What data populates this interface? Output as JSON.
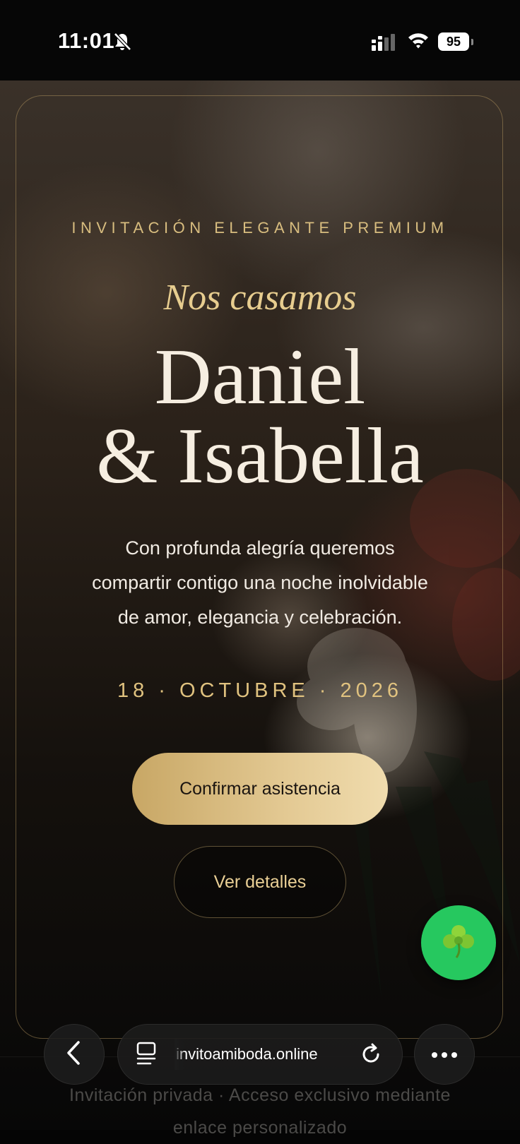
{
  "status_bar": {
    "time": "11:01",
    "battery": "95",
    "icons": [
      "bell-slash-icon",
      "signal-icon",
      "wifi-icon",
      "battery-icon"
    ]
  },
  "hero": {
    "kicker": "INVITACIÓN ELEGANTE PREMIUM",
    "script_title": "Nos casamos",
    "name_line_1": "Daniel",
    "name_line_2": "& Isabella",
    "intro_line_1": "Con profunda alegría queremos",
    "intro_line_2": "compartir contigo una noche inolvidable",
    "intro_line_3": "de amor, elegancia y celebración.",
    "date": "18 · OCTUBRE · 2026",
    "confirm_label": "Confirmar asistencia",
    "details_label": "Ver detalles"
  },
  "fab": {
    "icon": "clover-icon",
    "color": "#26c85f"
  },
  "footer": {
    "line_1": "Invitación privada · Acceso exclusivo mediante",
    "line_2": "enlace personalizado"
  },
  "browser": {
    "url": "invitoamiboda.online",
    "back_icon": "chevron-left-icon",
    "tabs_icon": "page-menu-icon",
    "reload_icon": "reload-icon",
    "more_icon": "more-icon"
  },
  "colors": {
    "gold": "#d8bd7f",
    "cream": "#f6eee1",
    "background": "#050505"
  }
}
